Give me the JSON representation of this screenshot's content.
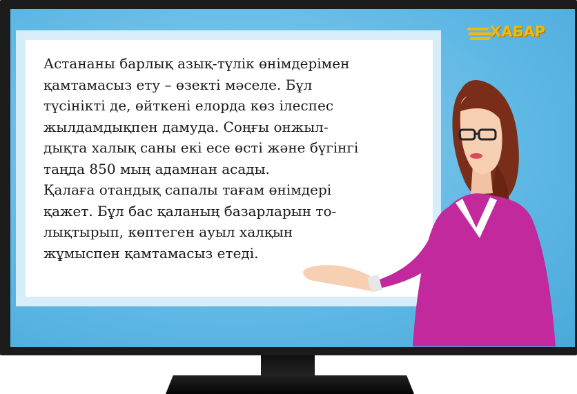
{
  "channel": {
    "logo_text": "ХАБАР",
    "logo_color": "#f2b90f"
  },
  "news": {
    "text": "Астананы барлық азық-түлік өнімдерімен\nқамтамасыз ету – өзекті мәселе. Бұл\nтүсінікті де, өйткені елорда көз ілеспес\nжылдамдықпен дамуда. Соңғы онжыл-\nдықта халық саны екі есе өсті және бүгінгі\nтаңда 850 мың адамнан асады.\nҚалаға отандық сапалы тағам өнімдері\nқажет. Бұл бас қаланың базарларын то-\nлықтырып, көптеген ауыл халқын\nжұмыспен қамтамасыз етеді."
  },
  "colors": {
    "screen": "#5fb8e4",
    "frame": "#1b1b1b",
    "presenter_dress": "#c2299c",
    "presenter_hair": "#7a2e1a"
  },
  "illustration": {
    "presenter": "woman-presenter-with-glasses-gesturing"
  }
}
